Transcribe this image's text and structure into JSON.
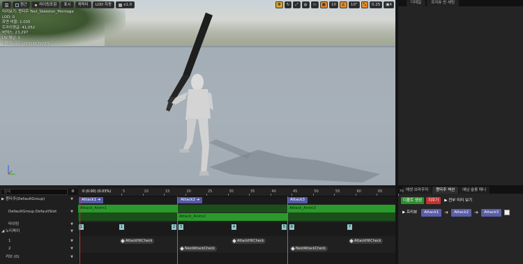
{
  "viewport": {
    "toolbar": {
      "menu_icon": "menu-icon",
      "perspective_label": "원근",
      "lit_label": "라이팅포함",
      "show_label": "표시",
      "character_label": "캐릭터",
      "lod_label": "LOD 자동",
      "speed_label": "x1.0"
    },
    "right_toolbar": {
      "grid_snap_value": "10",
      "angle_snap_value": "10°",
      "scale_snap_value": "0.25",
      "camera_speed_value": "4"
    },
    "stats": [
      "미리보기: 몽타주 Test_Skeleton_Montage",
      "LOD: 0",
      "화면 비율: 1.035",
      "트라이앵글: 41,052",
      "버텍스: 23,297",
      "UV 채널: 1",
      "대략적 크기: 227x117x283"
    ]
  },
  "details_panel": {
    "tabs": [
      "디테일",
      "프리뷰 씬 세팅"
    ]
  },
  "bottom_right": {
    "tabs": [
      "에셋 브라우저",
      "몽타주 섹션",
      "애님 슬롯 매니"
    ],
    "create_default_label": "디폴트 생성",
    "clear_label": "지우기",
    "preview_all_label": "▶ 전부 미리 보기",
    "preview_label": "▶ 프리뷰",
    "sections": [
      "Attack1",
      "Attack2",
      "Attack3"
    ],
    "colors": {
      "green": "#2f8e2f",
      "red": "#c43030",
      "section": "#5a5ea8"
    }
  },
  "montage": {
    "search_placeholder": "검색",
    "tree": {
      "group_label": "▶ 몽타주(DefaultGroup)",
      "slot_label": "DefaultGroup.DefaultSlot",
      "timing_label": "타이밍",
      "notify_label": "◢ 노티파이",
      "track1_label": "1",
      "track2_label": "2",
      "curves_label": "커브 (0)"
    },
    "ruler": {
      "position_label": "0 (0.00) (0.03%)",
      "ticks": [
        "5",
        "10",
        "15",
        "20",
        "25",
        "30",
        "35",
        "40",
        "45",
        "50",
        "55",
        "60",
        "65",
        "70"
      ]
    },
    "sections": [
      {
        "name": "Attack1"
      },
      {
        "name": "Attack2"
      },
      {
        "name": "Attack3"
      }
    ],
    "segments": [
      {
        "name": "Attack_Anim1"
      },
      {
        "name": "Attack_Anim2"
      },
      {
        "name": "Attack_Anim3"
      }
    ],
    "timing_markers": [
      "1",
      "1",
      "2",
      "3",
      "4",
      "5",
      "6",
      "7"
    ],
    "notifies": [
      "AttackHitCheck",
      "NextAttackCheck",
      "AttackHitCheck",
      "NextAttackCheck",
      "AttackHitCheck"
    ],
    "colors": {
      "segment_green": "#2a9a2a",
      "segment_dark": "#1e6b1e",
      "section": "#5459a3",
      "marker": "#8ec8c8"
    }
  }
}
